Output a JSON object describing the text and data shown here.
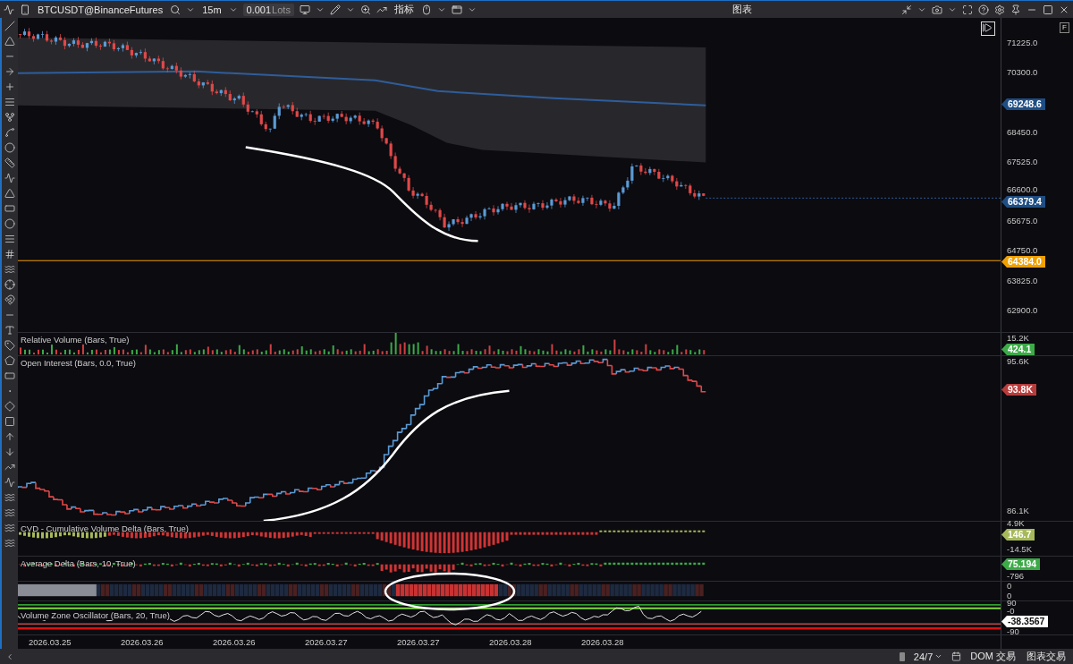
{
  "toolbar": {
    "symbol": "BTCUSDT@BinanceFutures",
    "interval": "15m",
    "lots_value": "0.001",
    "lots_unit": "Lots",
    "indicators": "指标"
  },
  "window": {
    "title": "图表"
  },
  "main_chart": {
    "scale_button": "F",
    "price_ticks": [
      "71225.0",
      "70300.0",
      "68450.0",
      "67525.0",
      "66600.0",
      "65675.0",
      "64750.0",
      "63825.0",
      "62900.0"
    ],
    "price_tags": [
      {
        "text": "69248.6",
        "color": "#1f4e84"
      },
      {
        "text": "66379.4",
        "color": "#1f4e84"
      },
      {
        "text": "64384.0",
        "color": "#f0a000"
      }
    ]
  },
  "panels": [
    {
      "kind": "volume",
      "title": "Relative Volume (Bars, True)",
      "axis_labels": [
        "15.2K"
      ],
      "tags": [
        {
          "text": "424.1",
          "color": "#3daa48"
        }
      ]
    },
    {
      "kind": "open_interest",
      "title": "Open Interest (Bars, 0.0, True)",
      "axis_labels": [
        "95.6K",
        "86.1K"
      ],
      "tags": [
        {
          "text": "93.8K",
          "color": "#b83c3c"
        }
      ]
    },
    {
      "kind": "cvd",
      "title": "CVD - Cumulative Volume Delta (Bars, True)",
      "axis_labels": [
        "4.9K",
        "-14.5K"
      ],
      "tags": [
        {
          "text": "146.7",
          "color": "#a6b95a"
        }
      ]
    },
    {
      "kind": "average_delta",
      "title": "Average Delta (Bars, 10, True)",
      "axis_labels": [
        "-796"
      ],
      "tags": [
        {
          "text": "75.194",
          "color": "#3daa48"
        }
      ]
    },
    {
      "kind": "heatmap",
      "axis_labels": [
        "0",
        "0"
      ]
    },
    {
      "kind": "oscillator",
      "title": "Volume Zone Oscillator (Bars, 20, True)",
      "axis_labels": [
        "90",
        "-0",
        "-90"
      ],
      "tags": [
        {
          "text": "-38.3567",
          "color": "#ffffff"
        }
      ]
    }
  ],
  "time_axis": [
    "2026.03.25",
    "2026.03.26",
    "2026.03.26",
    "2026.03.27",
    "2026.03.27",
    "2026.03.28",
    "2026.03.28"
  ],
  "status_bar": {
    "session": "24/7",
    "dom": "DOM 交易",
    "chart_trade": "图表交易"
  }
}
